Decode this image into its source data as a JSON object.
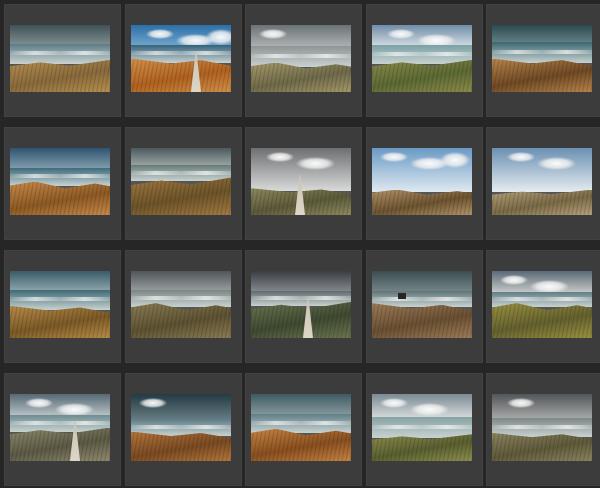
{
  "gallery": {
    "thumbnails": [
      {
        "sky": [
          "#3f5358",
          "#8a9797"
        ],
        "sea": "#5d7c87",
        "land": [
          "#8a6a3c",
          "#b5904f"
        ],
        "clouds": 0
      },
      {
        "sky": [
          "#2d6fa7",
          "#7aaed2"
        ],
        "sea": "#35627a",
        "land": [
          "#b0621f",
          "#d2904a"
        ],
        "clouds": 3
      },
      {
        "sky": [
          "#6c7378",
          "#b7bcbc"
        ],
        "sea": "#8f9595",
        "land": [
          "#6f6a4a",
          "#a59868"
        ],
        "clouds": 1
      },
      {
        "sky": [
          "#6f8da8",
          "#dfe6ea"
        ],
        "sea": "#7aa1a6",
        "land": [
          "#5c6a34",
          "#8c8a4a"
        ],
        "clouds": 2
      },
      {
        "sky": [
          "#2b4a52",
          "#6f8a8c"
        ],
        "sea": "#3b6570",
        "land": [
          "#6f4a24",
          "#b8844a"
        ],
        "clouds": 0
      },
      {
        "sky": [
          "#2f5470",
          "#8fa9b8"
        ],
        "sea": "#3e6b7c",
        "land": [
          "#8d5a24",
          "#c7894a"
        ],
        "clouds": 0
      },
      {
        "sky": [
          "#4b5a5e",
          "#aab2b0"
        ],
        "sea": "#667b78",
        "land": [
          "#6d5429",
          "#a27a42"
        ],
        "clouds": 0
      },
      {
        "sky": [
          "#6d6f71",
          "#d9dada"
        ],
        "sea": null,
        "land": [
          "#5c5a3a",
          "#8d8a5d"
        ],
        "clouds": 2
      },
      {
        "sky": [
          "#6a9ac4",
          "#dfe9f1"
        ],
        "sea": null,
        "land": [
          "#6d5430",
          "#b19268"
        ],
        "clouds": 3
      },
      {
        "sky": [
          "#6b90b2",
          "#e6ecf0"
        ],
        "sea": null,
        "land": [
          "#7a6a46",
          "#b6a27a"
        ],
        "clouds": 2
      },
      {
        "sky": [
          "#385c68",
          "#9bb0b5"
        ],
        "sea": "#3f6976",
        "land": [
          "#7c5a27",
          "#b78b48"
        ],
        "clouds": 0
      },
      {
        "sky": [
          "#4f5559",
          "#a4a8a8"
        ],
        "sea": "#7a8683",
        "land": [
          "#5d5233",
          "#8a7b52"
        ],
        "clouds": 0
      },
      {
        "sky": [
          "#3a3e44",
          "#8f959a"
        ],
        "sea": "#5f6b6c",
        "land": [
          "#3f4a32",
          "#6a7550"
        ],
        "clouds": 0
      },
      {
        "sky": [
          "#3c4d52",
          "#7e8e8f"
        ],
        "sea": "#5e7478",
        "land": [
          "#6a4f33",
          "#9c7c56"
        ],
        "clouds": 0
      },
      {
        "sky": [
          "#5a6a78",
          "#d7d8d2"
        ],
        "sea": "#617d86",
        "land": [
          "#64612f",
          "#999140"
        ],
        "clouds": 2
      },
      {
        "sky": [
          "#566a74",
          "#c7d0d2"
        ],
        "sea": "#6d8c92",
        "land": [
          "#5c5a45",
          "#8f8a6e"
        ],
        "clouds": 2
      },
      {
        "sky": [
          "#243a44",
          "#6f848a"
        ],
        "sea": "#5b7b86",
        "land": [
          "#7a4a22",
          "#b2763c"
        ],
        "clouds": 1
      },
      {
        "sky": [
          "#3f5a62",
          "#8fa3a6"
        ],
        "sea": "#5f7f87",
        "land": [
          "#8a4f1f",
          "#c58444"
        ],
        "clouds": 0
      },
      {
        "sky": [
          "#7a8a94",
          "#e2e5e4"
        ],
        "sea": "#88a2a4",
        "land": [
          "#5a5f30",
          "#8d8f4c"
        ],
        "clouds": 2
      },
      {
        "sky": [
          "#525658",
          "#b3b5b3"
        ],
        "sea": "#7e8886",
        "land": [
          "#5f5a3a",
          "#8b8360"
        ],
        "clouds": 1
      }
    ]
  }
}
